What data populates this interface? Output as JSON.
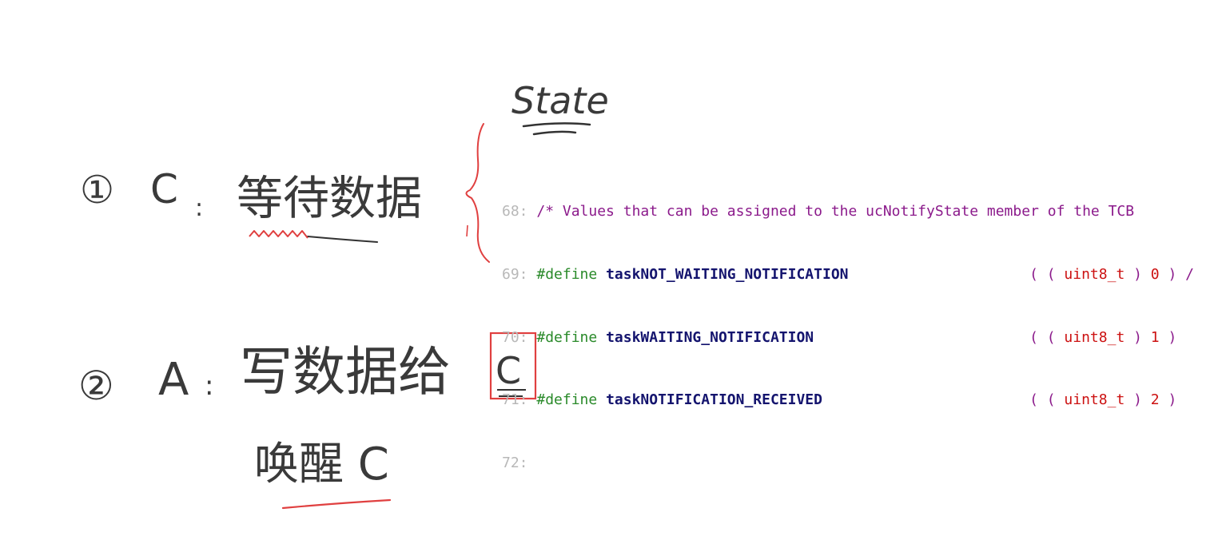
{
  "annotations": {
    "state_label": "State",
    "item1": {
      "number": "①",
      "actor": "C",
      "separator": ":",
      "text": "等待数据"
    },
    "item2": {
      "number": "②",
      "actor": "A",
      "separator": ":",
      "text": "写数据给",
      "target": "C",
      "wake_text": "唤醒 C"
    }
  },
  "code": {
    "lines": [
      {
        "ln": "68:",
        "comment": "/* Values that can be assigned to the ucNotifyState member of the TCB"
      },
      {
        "ln": "69:",
        "keyword": "#define",
        "ident": "taskNOT_WAITING_NOTIFICATION",
        "open": "( ( ",
        "type": "uint8_t",
        "mid": " ) ",
        "value": "0",
        "close": " ) /"
      },
      {
        "ln": "70:",
        "keyword": "#define",
        "ident": "taskWAITING_NOTIFICATION",
        "open": "( ( ",
        "type": "uint8_t",
        "mid": " ) ",
        "value": "1",
        "close": " )"
      },
      {
        "ln": "71:",
        "keyword": "#define",
        "ident": "taskNOTIFICATION_RECEIVED",
        "open": "( ( ",
        "type": "uint8_t",
        "mid": " ) ",
        "value": "2",
        "close": " )"
      },
      {
        "ln": "72:"
      }
    ]
  },
  "colors": {
    "background": "#ffffff",
    "ink": "#3a3a3a",
    "red_ink": "#e04040",
    "comment": "#8b1a8b",
    "keyword": "#2a8a2a",
    "identifier": "#14146e",
    "number": "#cc1111",
    "line_number": "#b8b8b8"
  }
}
